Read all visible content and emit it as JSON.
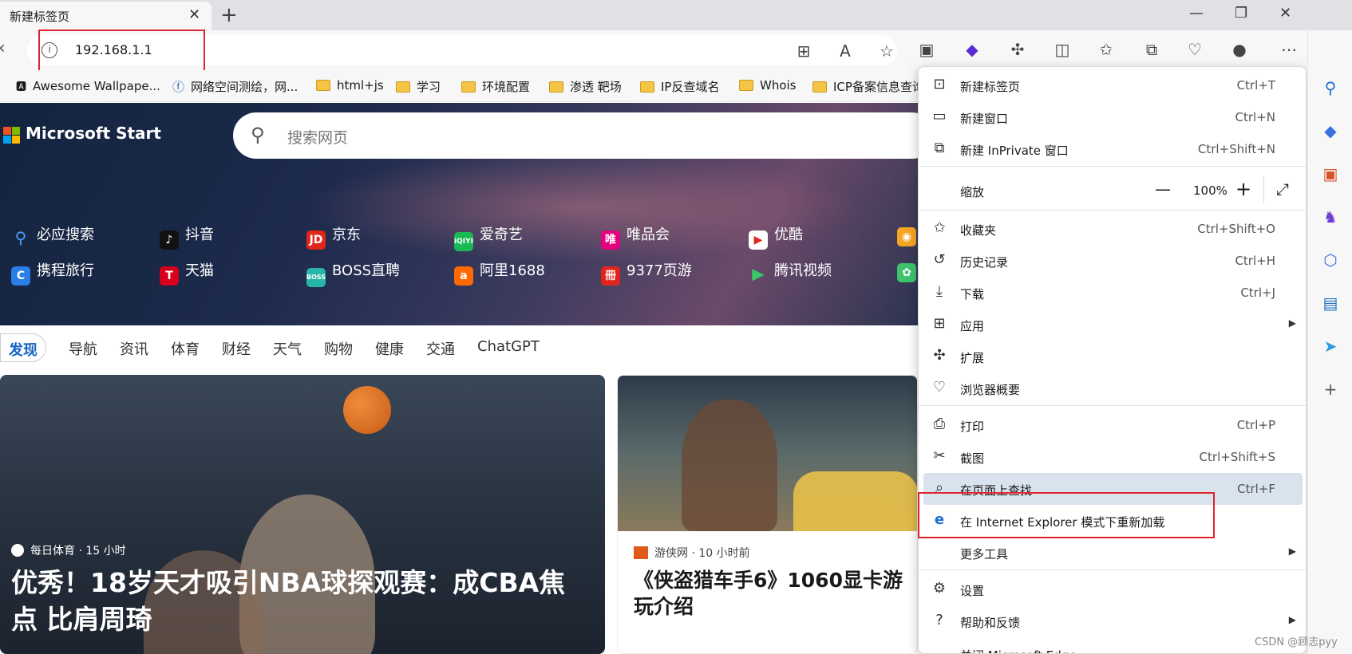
{
  "tab": {
    "title": "新建标签页"
  },
  "address": {
    "url": "192.168.1.1"
  },
  "bookmarks": [
    "Awesome Wallpape...",
    "网络空间测绘，网...",
    "html+js",
    "学习",
    "环境配置",
    "渗透 靶场",
    "IP反查域名",
    "Whois",
    "ICP备案信息查询"
  ],
  "hero": {
    "brand": "Microsoft Start",
    "search_placeholder": "搜索网页",
    "quick_links_row1": [
      "必应搜索",
      "抖音",
      "京东",
      "爱奇艺",
      "唯品会",
      "优酷"
    ],
    "quick_links_row2": [
      "携程旅行",
      "天猫",
      "BOSS直聘",
      "阿里1688",
      "9377页游",
      "腾讯视频"
    ]
  },
  "categories": [
    "发现",
    "导航",
    "资讯",
    "体育",
    "财经",
    "天气",
    "购物",
    "健康",
    "交通",
    "ChatGPT"
  ],
  "cards": [
    {
      "source": "每日体育 · 15 小时",
      "headline": "优秀！18岁天才吸引NBA球探观赛：成CBA焦点 比肩周琦"
    },
    {
      "source": "游侠网 · 10 小时前",
      "headline": "《侠盗猎车手6》1060显卡游玩介绍"
    }
  ],
  "menu": {
    "new_tab": {
      "label": "新建标签页",
      "shortcut": "Ctrl+T"
    },
    "new_window": {
      "label": "新建窗口",
      "shortcut": "Ctrl+N"
    },
    "new_inprivate": {
      "label": "新建 InPrivate 窗口",
      "shortcut": "Ctrl+Shift+N"
    },
    "zoom": {
      "label": "缩放",
      "value": "100%"
    },
    "favorites": {
      "label": "收藏夹",
      "shortcut": "Ctrl+Shift+O"
    },
    "history": {
      "label": "历史记录",
      "shortcut": "Ctrl+H"
    },
    "downloads": {
      "label": "下载",
      "shortcut": "Ctrl+J"
    },
    "apps": {
      "label": "应用"
    },
    "extensions": {
      "label": "扩展"
    },
    "browser_essentials": {
      "label": "浏览器概要"
    },
    "print": {
      "label": "打印",
      "shortcut": "Ctrl+P"
    },
    "screenshot": {
      "label": "截图",
      "shortcut": "Ctrl+Shift+S"
    },
    "find": {
      "label": "在页面上查找",
      "shortcut": "Ctrl+F"
    },
    "ie_mode": {
      "label": "在 Internet Explorer 模式下重新加载"
    },
    "more_tools": {
      "label": "更多工具"
    },
    "settings": {
      "label": "设置"
    },
    "help": {
      "label": "帮助和反馈"
    },
    "close": {
      "label": "关闭 Microsoft Edge"
    }
  },
  "watermark": "CSDN @顾志pyy",
  "colors": {
    "accent": "#1463c4",
    "highlight_box": "#e0242b",
    "menu_hover": "#d9e3ee"
  }
}
